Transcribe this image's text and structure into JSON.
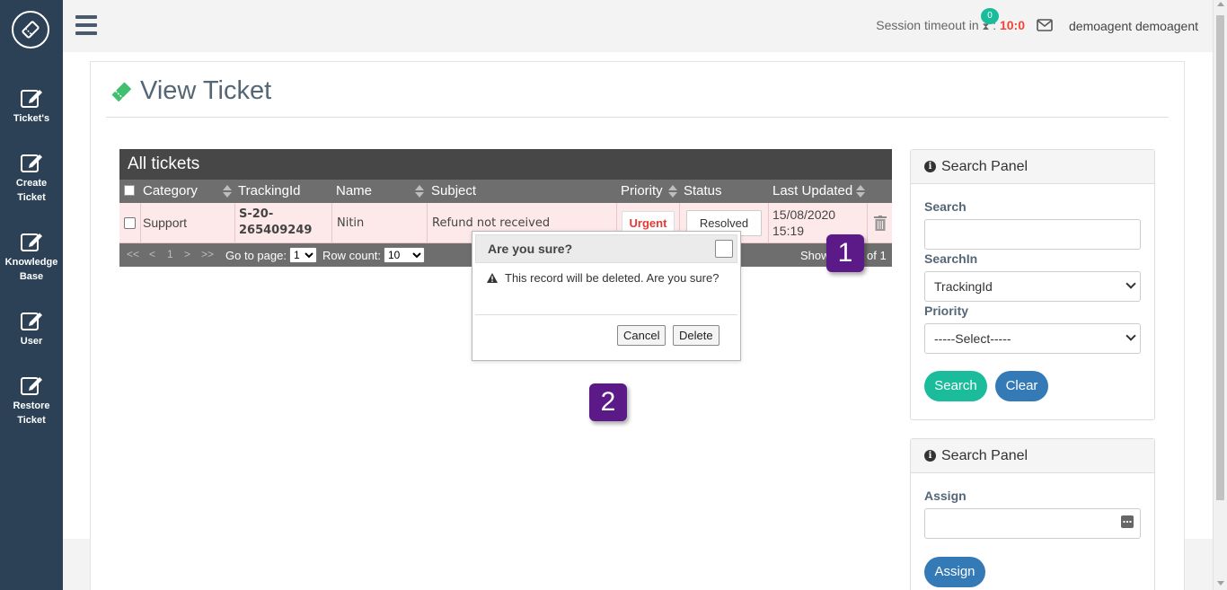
{
  "sidebar": {
    "items": [
      {
        "label": "Ticket's",
        "icon": "edit-icon"
      },
      {
        "label": "Create\nTicket",
        "icon": "edit-icon"
      },
      {
        "label": "Knowledge\nBase",
        "icon": "edit-icon"
      },
      {
        "label": "User",
        "icon": "edit-icon"
      },
      {
        "label": "Restore\nTicket",
        "icon": "edit-icon"
      }
    ]
  },
  "topbar": {
    "session_label": "Session timeout in",
    "session_sep": ":",
    "session_timer": "10:0",
    "mail_count": "0",
    "username": "demoagent demoagent"
  },
  "page": {
    "title": "View Ticket"
  },
  "grid": {
    "caption": "All tickets",
    "columns": [
      "Category",
      "TrackingId",
      "Name",
      "Subject",
      "Priority",
      "Status",
      "Last Updated"
    ],
    "rows": [
      {
        "category": "Support",
        "tracking_line1": "S-20-",
        "tracking_line2": "265409249",
        "name": "Nitin",
        "subject": "Refund not received",
        "priority": "Urgent",
        "status": "Resolved",
        "updated_line1": "15/08/2020",
        "updated_line2": "15:19"
      }
    ],
    "pager": {
      "first": "<<",
      "prev": "<",
      "page": "1",
      "next": ">",
      "last": ">>",
      "goto_label": "Go to page:",
      "goto_value": "1",
      "rowcount_label": "Row count:",
      "rowcount_value": "10",
      "showing_start": "Show",
      "showing_end": "of 1"
    }
  },
  "dialog": {
    "title": "Are you sure?",
    "message": "This record will be deleted. Are you sure?",
    "cancel_label": "Cancel",
    "delete_label": "Delete"
  },
  "callouts": [
    "1",
    "2"
  ],
  "search_panel": {
    "title": "Search Panel",
    "search_label": "Search",
    "search_value": "",
    "searchin_label": "SearchIn",
    "searchin_value": "TrackingId",
    "priority_label": "Priority",
    "priority_value": "-----Select-----",
    "search_button": "Search",
    "clear_button": "Clear"
  },
  "assign_panel": {
    "title": "Search Panel",
    "assign_label": "Assign",
    "assign_value": "",
    "assign_button": "Assign"
  },
  "colors": {
    "sidebar": "#2c4156",
    "accent_green": "#1abc9c",
    "accent_blue": "#337ab7",
    "urgent": "#e53935",
    "callout": "#5b1a87"
  }
}
